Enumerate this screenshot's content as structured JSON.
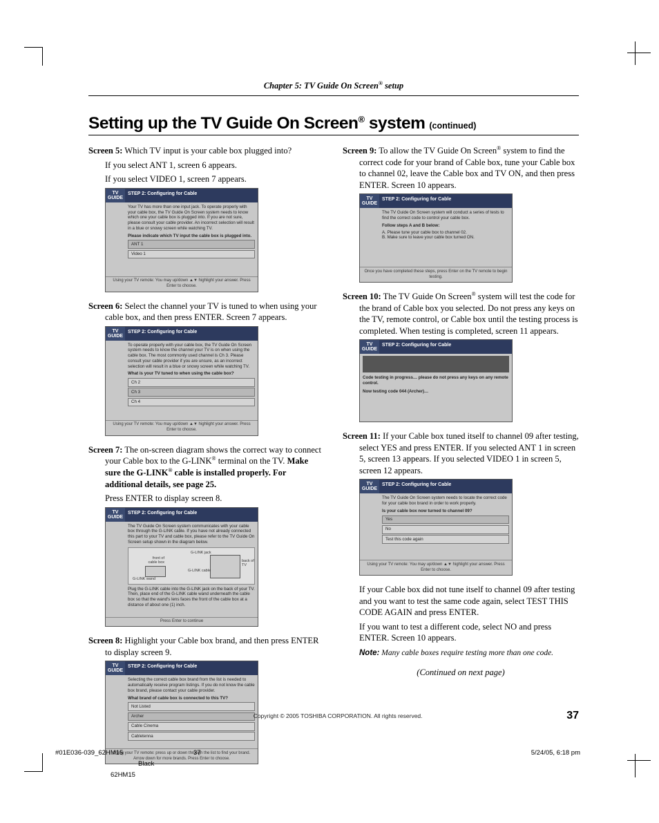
{
  "header": {
    "chapter": "Chapter 5: TV Guide On Screen",
    "reg": "®",
    "suffix": " setup"
  },
  "title": {
    "main": "Setting up the TV Guide On Screen",
    "reg": "®",
    "tail": " system",
    "cont": "(continued)"
  },
  "left": {
    "s5": {
      "label": "Screen 5:",
      "text": " Which TV input is your cable box plugged into?",
      "l2": "If you select ANT 1, screen 6 appears.",
      "l3": "If you select VIDEO 1, screen 7 appears."
    },
    "shot5": {
      "step": "STEP 2: Configuring for Cable",
      "intro": "Your TV has more than one input jack. To operate properly with your cable box, the TV Guide On Screen system needs to know which one your cable box is plugged into. If you are not sure, please consult your cable provider. An incorrect selection will result in a blue or snowy screen while watching TV.",
      "q": "Please indicate which TV input the cable box is plugged into.",
      "opts": [
        "ANT 1",
        "Video 1"
      ],
      "bottom": "Using your TV remote: You may up/down ▲▼ highlight your answer. Press Enter to choose."
    },
    "s6": {
      "label": "Screen 6:",
      "text": " Select the channel your TV is tuned to when using your cable box, and then press ENTER. Screen 7 appears."
    },
    "shot6": {
      "step": "STEP 2: Configuring for Cable",
      "intro": "To operate properly with your cable box, the TV Guide On Screen system needs to know the channel your TV is on when using the cable box. The most commonly used channel is Ch 3. Please consult your cable provider if you are unsure, as an incorrect selection will result in a blue or snowy screen while watching TV.",
      "q": "What is your TV tuned to when using the cable box?",
      "opts": [
        "Ch 2",
        "Ch 3",
        "Ch 4"
      ],
      "bottom": "Using your TV remote: You may up/down ▲▼ highlight your answer. Press Enter to choose."
    },
    "s7": {
      "label": "Screen 7:",
      "text": " The on-screen diagram shows the correct way to connect your Cable box to the G-LINK",
      "reg": "®",
      "text2": " terminal on the TV. ",
      "bold": "Make sure the G-LINK",
      "boldreg": "®",
      "bold2": " cable is installed properly. For additional details, see page 25.",
      "l2": "Press ENTER to display screen 8."
    },
    "shot7": {
      "step": "STEP 2: Configuring for Cable",
      "intro": "The TV Guide On Screen system communicates with your cable box through the G-LINK cable. If you have not already connected this part to your TV and cable box, please refer to the TV Guide On Screen setup shown in the diagram below.",
      "dia": {
        "a": "front of cable box",
        "b": "G-LINK jack",
        "c": "back of TV",
        "d": "G-LINK cable",
        "e": "G-LINK wand"
      },
      "body2": "Plug the G-LINK cable into the G-LINK jack on the back of your TV. Then, place end of the G-LINK cable wand underneath the cable box so that the wand's lens faces the front of the cable box at a distance of about one (1) inch.",
      "bottom": "Press Enter to continue"
    },
    "s8": {
      "label": "Screen 8:",
      "text": " Highlight your Cable box brand, and then press ENTER to display screen 9."
    },
    "shot8": {
      "step": "STEP 2: Configuring for Cable",
      "intro": "Selecting the correct cable box brand from the list is needed to automatically receive program listings. If you do not know the cable box brand, please contact your cable provider.",
      "q": "What brand of cable box is connected to this TV?",
      "opts": [
        "Not Listed",
        "Archer",
        "Cable Cinema",
        "Cabletenna"
      ],
      "bottom": "Using your TV remote: press up or down through the list to find your brand. Arrow down for more brands. Press Enter to choose."
    }
  },
  "right": {
    "s9": {
      "label": "Screen 9:",
      "text": " To allow the TV Guide On Screen",
      "reg": "®",
      "text2": " system to find the correct code for your brand of Cable box, tune your Cable box to channel 02, leave the Cable box and TV ON, and then press ENTER. Screen 10 appears."
    },
    "shot9": {
      "step": "STEP 2: Configuring for Cable",
      "intro": "The TV Guide On Screen system will conduct a series of tests to find the correct code to control your cable box.",
      "q": "Follow steps A and B below:",
      "a": "A.  Please tune your cable box to channel 02.",
      "b": "B.  Make sure to leave your cable box turned ON.",
      "bottom": "Once you have completed these steps, press Enter on the TV remote to begin testing."
    },
    "s10": {
      "label": "Screen 10:",
      "text": " The TV Guide On Screen",
      "reg": "®",
      "text2": " system will test the code for the brand of Cable box you selected. Do not press any keys on the TV, remote control, or Cable box until the testing process is completed. When testing is completed, screen 11 appears."
    },
    "shot10": {
      "step": "STEP 2: Configuring for Cable",
      "msg1": "Code testing in progress… please do not press any keys on any remote control.",
      "msg2": "Now testing code 044 (Archer)…"
    },
    "s11": {
      "label": "Screen 11:",
      "text": " If your Cable box tuned itself to channel 09 after testing, select YES and press ENTER. If you selected ANT 1 in screen 5, screen 13 appears. If you selected VIDEO 1 in screen 5, screen 12 appears."
    },
    "shot11": {
      "step": "STEP 2: Configuring for Cable",
      "intro": "The TV Guide On Screen system needs to locate the correct code for your cable box brand in order to work properly.",
      "q": "Is your cable box now turned to channel 09?",
      "opts": [
        "Yes",
        "No",
        "Test this code again"
      ],
      "bottom": "Using your TV remote: You may up/down ▲▼ highlight your answer. Press Enter to choose."
    },
    "p1": "If your Cable box did not tune itself to channel 09 after testing and you want to test the same code again, select TEST THIS CODE AGAIN and press ENTER.",
    "p2": "If you want to test a different code, select NO and press ENTER. Screen 10 appears.",
    "note": {
      "label": "Note:",
      "body": " Many cable boxes require testing more than one code."
    },
    "continued": "(Continued on next page)"
  },
  "copyright": "Copyright © 2005 TOSHIBA CORPORATION. All rights reserved.",
  "pagenum": "37",
  "footer": {
    "left": "#01E036-039_62HM15",
    "mid": "37",
    "right": "5/24/05, 6:18 pm",
    "black": "Black",
    "model": "62HM15"
  }
}
